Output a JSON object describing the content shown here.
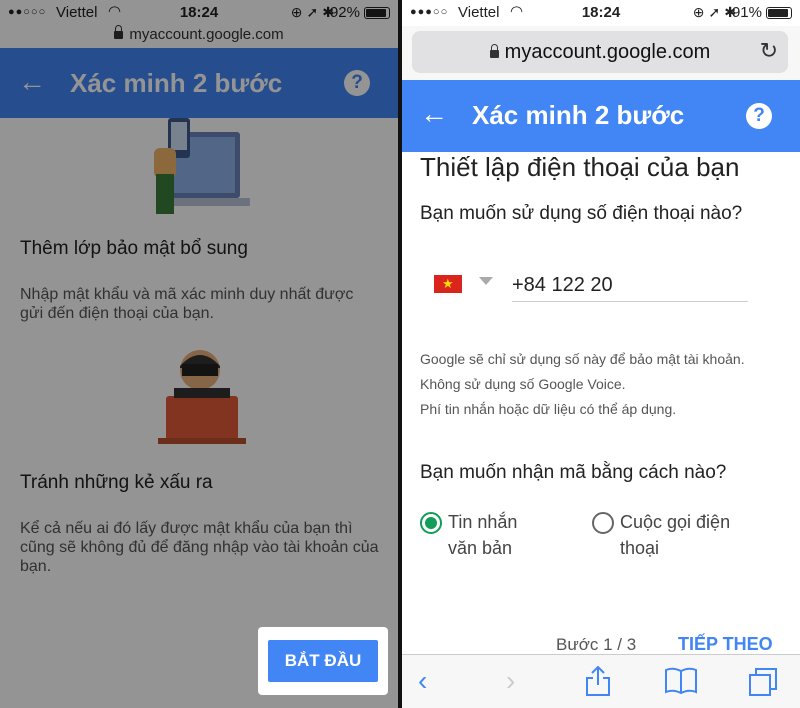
{
  "left": {
    "status": {
      "carrier": "Viettel",
      "time": "18:24",
      "battery": "92%"
    },
    "url": "myaccount.google.com",
    "appbar": {
      "back": "←",
      "title": "Xác minh 2 bước",
      "help": "?"
    },
    "section1": {
      "heading": "Thêm lớp bảo mật bổ sung",
      "body": "Nhập mật khẩu và mã xác minh duy nhất được gửi đến điện thoại của bạn."
    },
    "section2": {
      "heading": "Tránh những kẻ xấu ra",
      "body": "Kể cả nếu ai đó lấy được mật khẩu của bạn thì cũng sẽ không đủ để đăng nhập vào tài khoản của bạn."
    },
    "start_button": "BẮT ĐẦU"
  },
  "right": {
    "status": {
      "carrier": "Viettel",
      "time": "18:24",
      "battery": "91%"
    },
    "url": "myaccount.google.com",
    "appbar": {
      "back": "←",
      "title": "Xác minh 2 bước",
      "help": "?"
    },
    "setup_title": "Thiết lập điện thoại của bạn",
    "phone_question": "Bạn muốn sử dụng số điện thoại nào?",
    "phone_value": "+84 122 20",
    "notes": [
      "Google sẽ chỉ sử dụng số này để bảo mật tài khoản.",
      "Không sử dụng số Google Voice.",
      "Phí tin nhắn hoặc dữ liệu có thể áp dụng."
    ],
    "method_question": "Bạn muốn nhận mã bằng cách nào?",
    "options": [
      {
        "label": "Tin nhắn văn bản",
        "selected": true
      },
      {
        "label": "Cuộc gọi điện thoại",
        "selected": false
      }
    ],
    "step": "Bước 1 / 3",
    "next": "TIẾP THEO"
  },
  "colors": {
    "brand": "#4285f4",
    "radio_selected": "#0f9d58"
  },
  "icons": [
    "wifi-icon",
    "lock-icon",
    "reload-icon",
    "back-icon",
    "help-icon",
    "share-icon",
    "bookmarks-icon",
    "tabs-icon"
  ]
}
